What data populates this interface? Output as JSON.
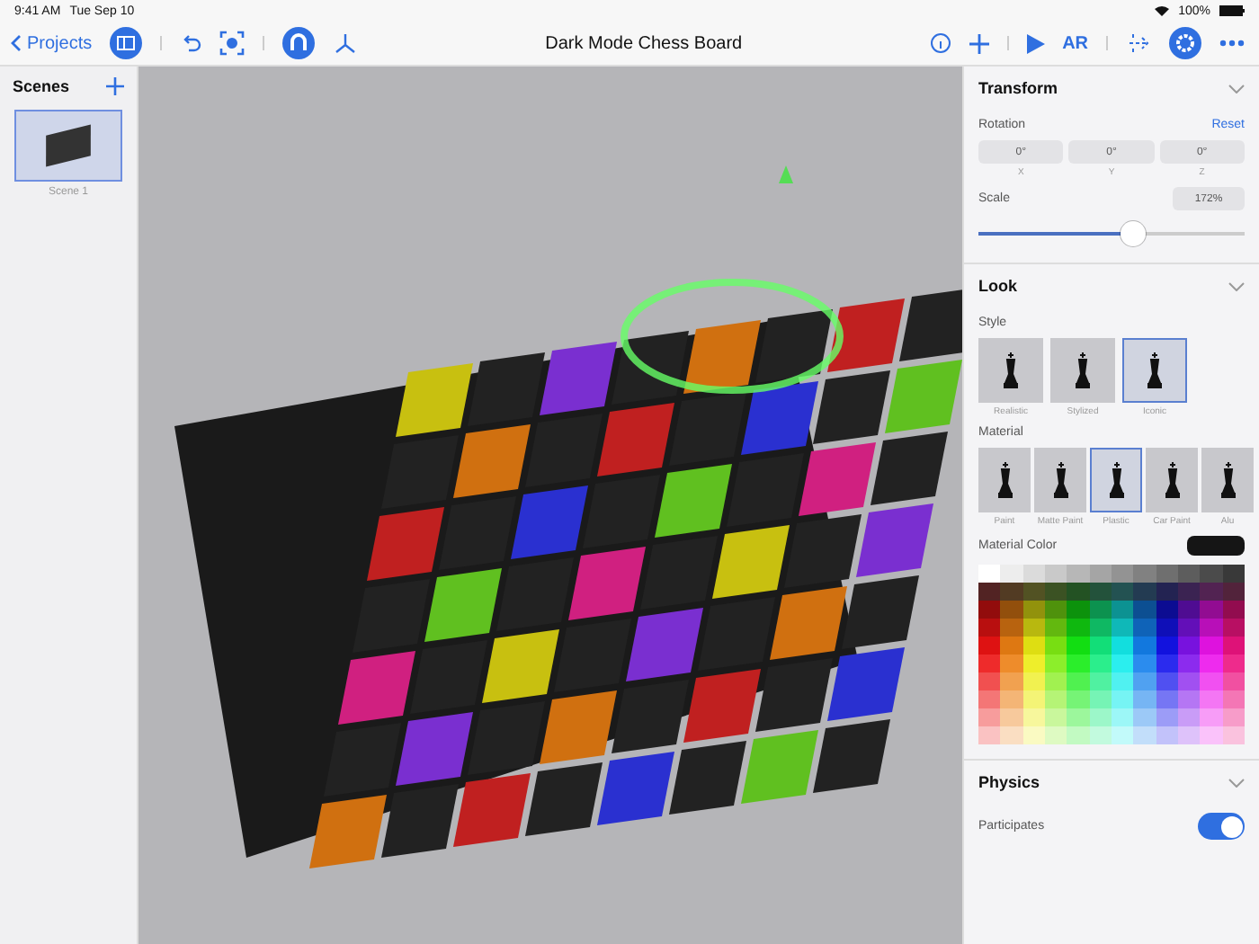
{
  "status_bar": {
    "time": "9:41 AM",
    "date": "Tue Sep 10",
    "battery": "100%"
  },
  "toolbar": {
    "back": "Projects",
    "title": "Dark Mode Chess Board",
    "ar": "AR"
  },
  "scenes": {
    "title": "Scenes",
    "items": [
      {
        "label": "Scene 1",
        "selected": true
      }
    ]
  },
  "inspector": {
    "transform": {
      "title": "Transform",
      "rotation_label": "Rotation",
      "reset": "Reset",
      "rotation": [
        {
          "value": "0°",
          "axis": "X"
        },
        {
          "value": "0°",
          "axis": "Y"
        },
        {
          "value": "0°",
          "axis": "Z"
        }
      ],
      "scale": {
        "label": "Scale",
        "value": "172%",
        "level": 0.58
      }
    },
    "look": {
      "title": "Look",
      "style_label": "Style",
      "styles": [
        {
          "label": "Realistic",
          "selected": false
        },
        {
          "label": "Stylized",
          "selected": false
        },
        {
          "label": "Iconic",
          "selected": true
        }
      ],
      "material_label": "Material",
      "materials": [
        {
          "label": "Paint",
          "selected": false
        },
        {
          "label": "Matte Paint",
          "selected": false
        },
        {
          "label": "Plastic",
          "selected": true
        },
        {
          "label": "Car Paint",
          "selected": false
        },
        {
          "label": "Alu",
          "selected": false
        }
      ],
      "color_label": "Material Color"
    },
    "physics": {
      "title": "Physics",
      "participates": {
        "label": "Participates",
        "on": true
      }
    }
  }
}
